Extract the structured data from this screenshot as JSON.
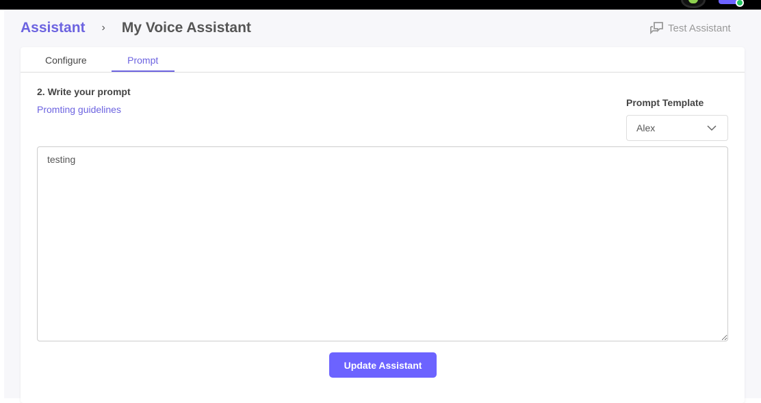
{
  "breadcrumb": {
    "root": "Assistant",
    "separator": "›",
    "current": "My Voice Assistant"
  },
  "header": {
    "test_label": "Test Assistant"
  },
  "tabs": [
    {
      "label": "Configure"
    },
    {
      "label": "Prompt"
    }
  ],
  "prompt": {
    "heading": "2. Write your prompt",
    "guidelines_link": "Promting guidelines",
    "template_label": "Prompt Template",
    "template_value": "Alex",
    "text": "testing"
  },
  "actions": {
    "update_label": "Update Assistant"
  },
  "colors": {
    "accent": "#6c63ff"
  }
}
